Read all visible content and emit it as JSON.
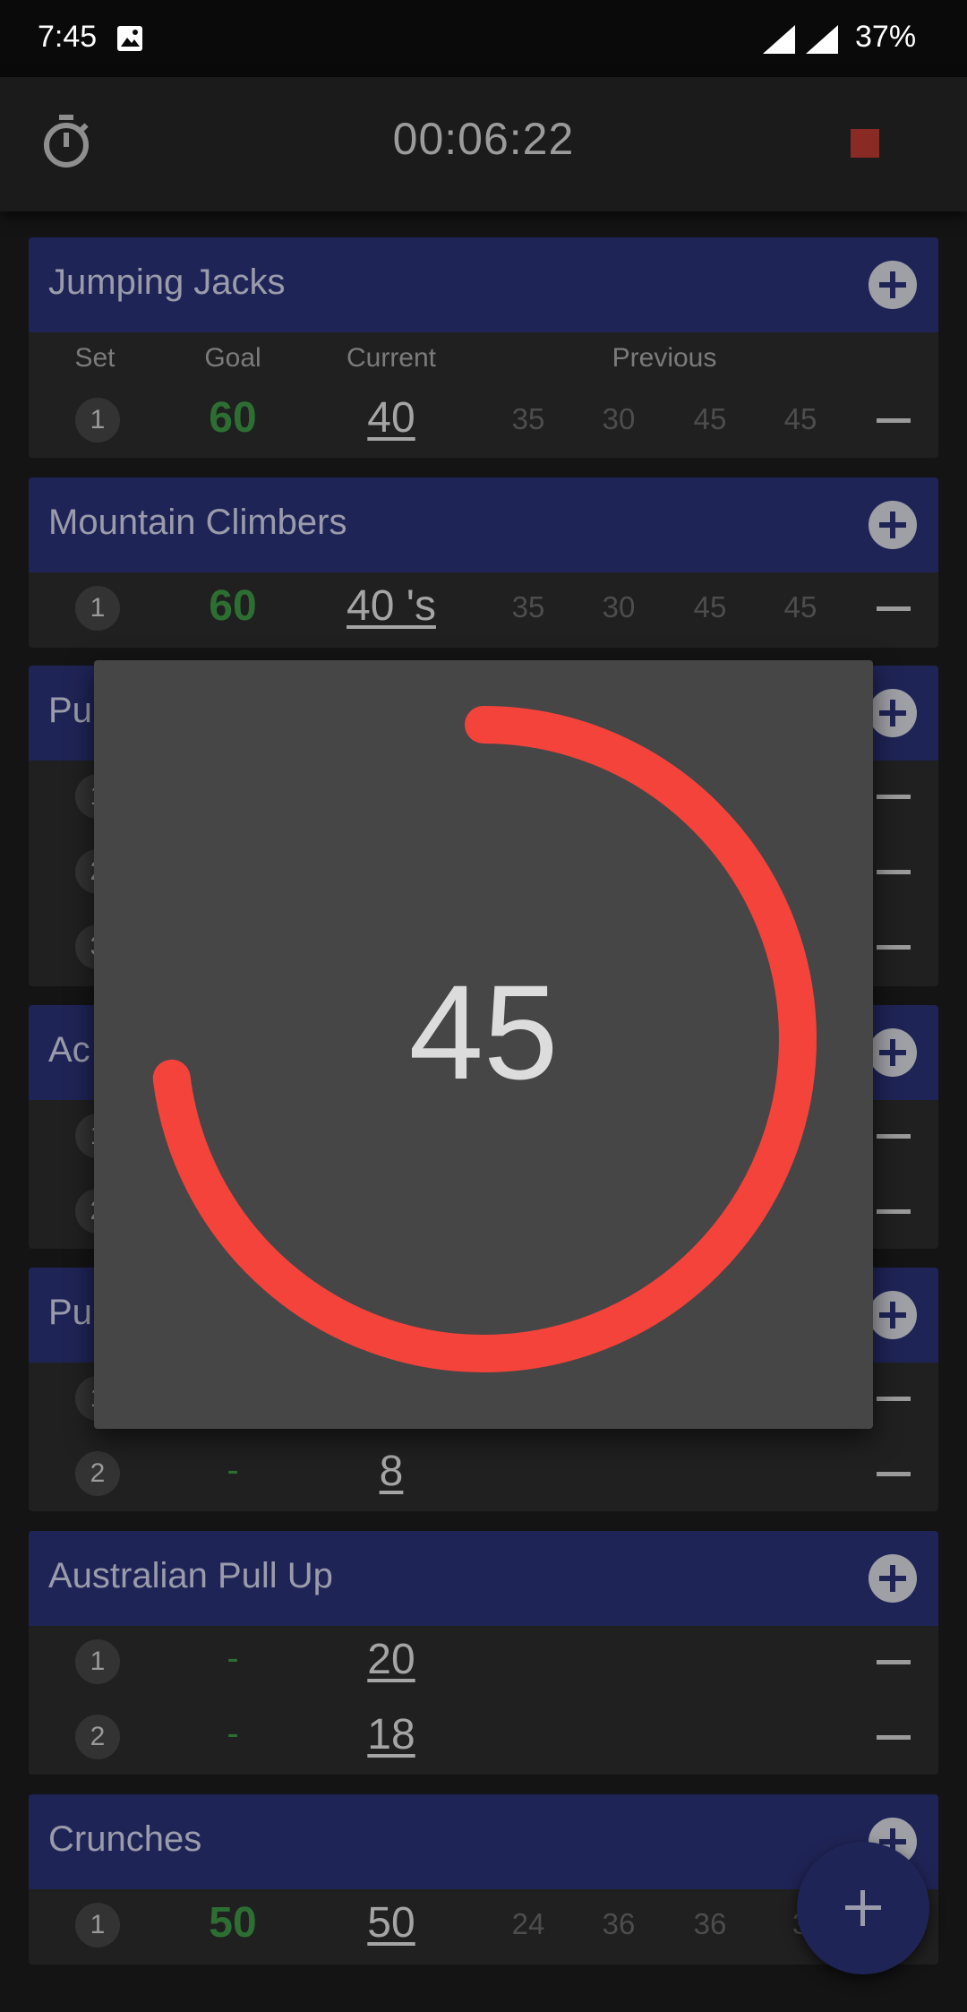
{
  "status_bar": {
    "time": "7:45",
    "battery": "37%",
    "icons": [
      "gallery-icon",
      "signal-icon",
      "signal-icon"
    ]
  },
  "toolbar": {
    "elapsed": "00:06:22",
    "timer_icon": "stopwatch-icon",
    "stop_icon": "stop-icon",
    "stop_color": "#8a2a24"
  },
  "columns": {
    "set": "Set",
    "goal": "Goal",
    "current": "Current",
    "previous": "Previous"
  },
  "exercises": [
    {
      "name": "Jumping Jacks",
      "sets": [
        {
          "set": "1",
          "goal": "60",
          "current": "40",
          "previous": [
            "35",
            "30",
            "45",
            "45"
          ]
        }
      ]
    },
    {
      "name": "Mountain Climbers",
      "sets": [
        {
          "set": "1",
          "goal": "60",
          "current": "40 's",
          "previous": [
            "35",
            "30",
            "45",
            "45"
          ]
        }
      ]
    },
    {
      "name": "Pu",
      "sets": [
        {
          "set": "1"
        },
        {
          "set": "2"
        },
        {
          "set": "3"
        }
      ]
    },
    {
      "name": "Ac",
      "sets": [
        {
          "set": "1"
        },
        {
          "set": "2"
        }
      ]
    },
    {
      "name": "Pu",
      "sets": [
        {
          "set": "1"
        },
        {
          "set": "2",
          "goal": "-",
          "current": "8"
        }
      ]
    },
    {
      "name": "Australian Pull Up",
      "sets": [
        {
          "set": "1",
          "goal": "-",
          "current": "20"
        },
        {
          "set": "2",
          "goal": "-",
          "current": "18"
        }
      ]
    },
    {
      "name": "Crunches",
      "sets": [
        {
          "set": "1",
          "goal": "50",
          "current": "50",
          "previous": [
            "24",
            "36",
            "36",
            "3"
          ]
        }
      ]
    }
  ],
  "rest_timer": {
    "value": "45",
    "progress_fraction": 0.73,
    "ring_color": "#f4433a"
  },
  "fab": {
    "icon": "plus-icon"
  },
  "colors": {
    "header": "#1f2456",
    "goal_green": "#2d6f32",
    "card": "#202020"
  }
}
